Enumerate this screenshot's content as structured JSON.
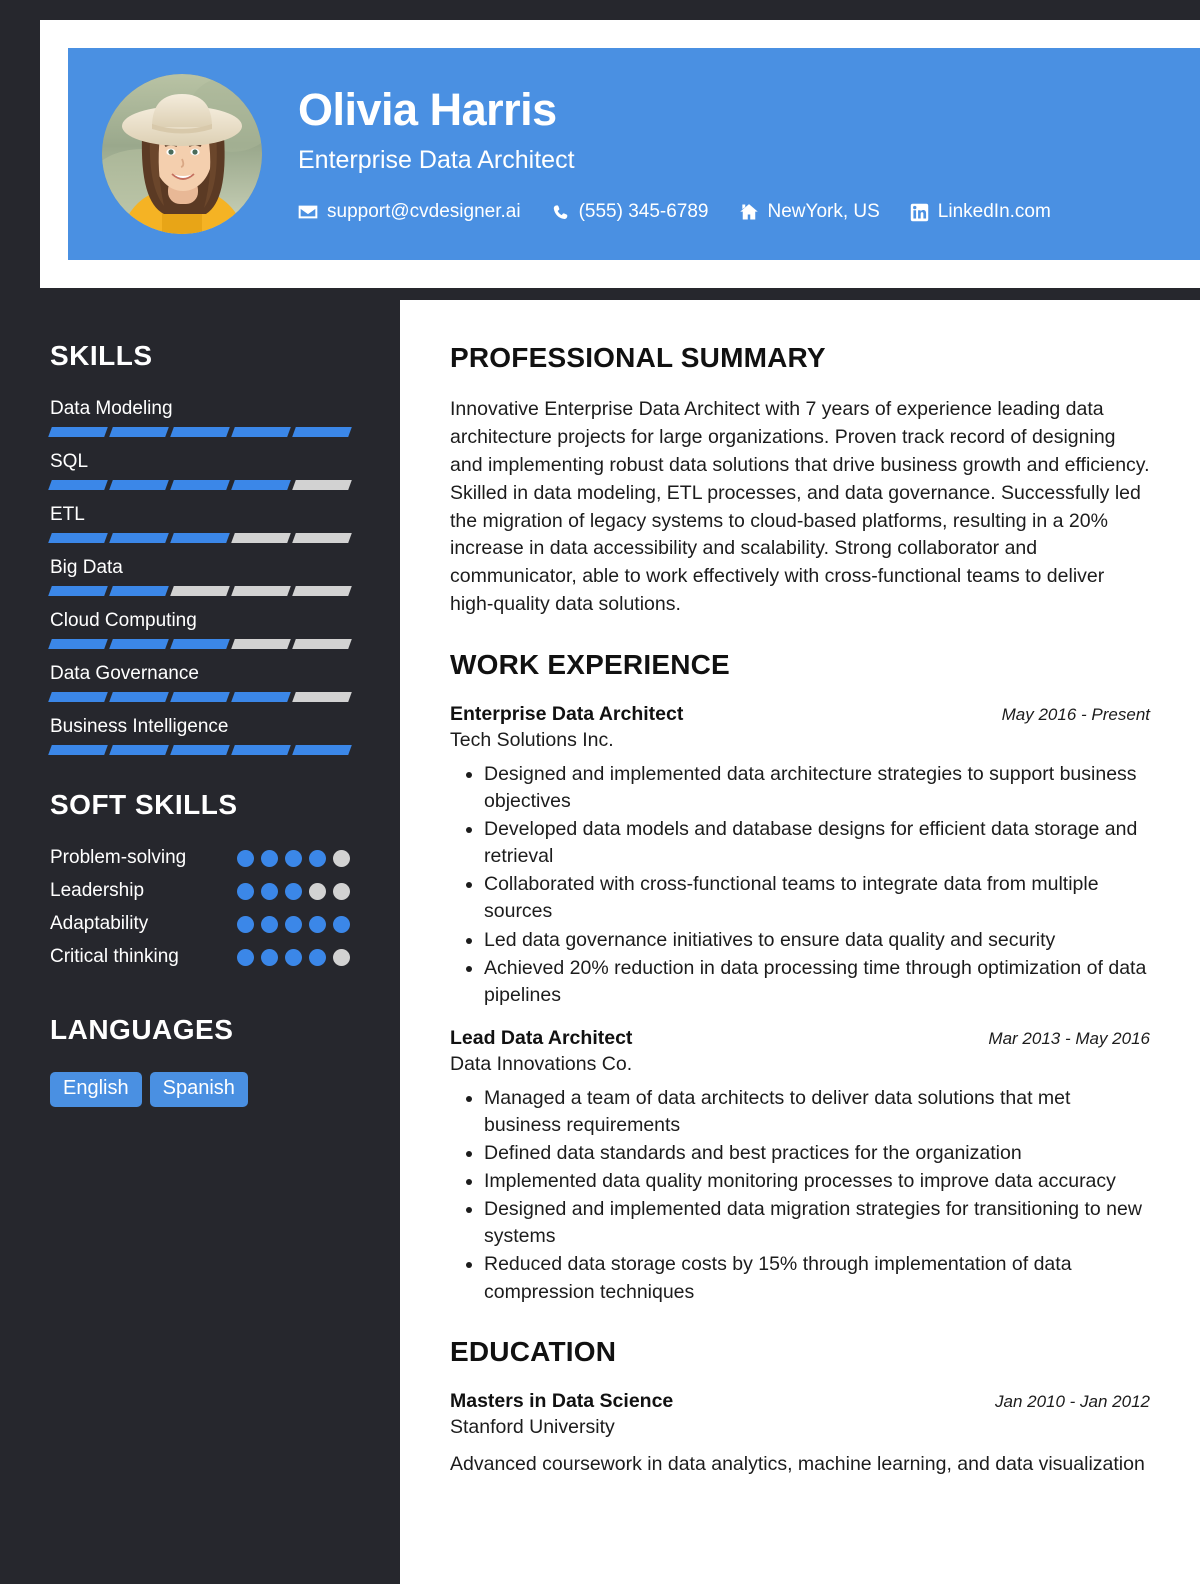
{
  "header": {
    "name": "Olivia Harris",
    "title": "Enterprise Data Architect",
    "avatar_alt": "profile-photo",
    "contacts": [
      {
        "icon": "envelope-icon",
        "text": "support@cvdesigner.ai"
      },
      {
        "icon": "phone-icon",
        "text": "(555) 345-6789"
      },
      {
        "icon": "home-icon",
        "text": "NewYork, US"
      },
      {
        "icon": "linkedin-icon",
        "text": "LinkedIn.com"
      }
    ]
  },
  "colors": {
    "accent_blue": "#4a90e2",
    "bar_blue": "#3b87e8",
    "bar_empty": "#d2d2d2",
    "sidebar_dark": "#26272d",
    "text_light": "#ffffff",
    "text_dark": "#1c1c1c"
  },
  "sidebar": {
    "skills_heading": "SKILLS",
    "skills_max": 5,
    "skills": [
      {
        "label": "Data Modeling",
        "level": 5
      },
      {
        "label": "SQL",
        "level": 4
      },
      {
        "label": "ETL",
        "level": 3
      },
      {
        "label": "Big Data",
        "level": 2
      },
      {
        "label": "Cloud Computing",
        "level": 3
      },
      {
        "label": "Data Governance",
        "level": 4
      },
      {
        "label": "Business Intelligence",
        "level": 5
      }
    ],
    "soft_skills_heading": "SOFT SKILLS",
    "soft_skills_max": 5,
    "soft_skills": [
      {
        "label": "Problem-solving",
        "level": 4
      },
      {
        "label": "Leadership",
        "level": 3
      },
      {
        "label": "Adaptability",
        "level": 5
      },
      {
        "label": "Critical thinking",
        "level": 4
      }
    ],
    "languages_heading": "LANGUAGES",
    "languages": [
      "English",
      "Spanish"
    ]
  },
  "main": {
    "summary_heading": "PROFESSIONAL SUMMARY",
    "summary_text": "Innovative Enterprise Data Architect with 7 years of experience leading data architecture projects for large organizations. Proven track record of designing and implementing robust data solutions that drive business growth and efficiency. Skilled in data modeling, ETL processes, and data governance. Successfully led the migration of legacy systems to cloud-based platforms, resulting in a 20% increase in data accessibility and scalability. Strong collaborator and communicator, able to work effectively with cross-functional teams to deliver high-quality data solutions.",
    "work_heading": "WORK EXPERIENCE",
    "work": [
      {
        "role": "Enterprise Data Architect",
        "dates": "May 2016 - Present",
        "org": "Tech Solutions Inc.",
        "bullets": [
          "Designed and implemented data architecture strategies to support business objectives",
          "Developed data models and database designs for efficient data storage and retrieval",
          "Collaborated with cross-functional teams to integrate data from multiple sources",
          "Led data governance initiatives to ensure data quality and security",
          "Achieved 20% reduction in data processing time through optimization of data pipelines"
        ]
      },
      {
        "role": "Lead Data Architect",
        "dates": "Mar 2013 - May 2016",
        "org": "Data Innovations Co.",
        "bullets": [
          "Managed a team of data architects to deliver data solutions that met business requirements",
          "Defined data standards and best practices for the organization",
          "Implemented data quality monitoring processes to improve data accuracy",
          "Designed and implemented data migration strategies for transitioning to new systems",
          "Reduced data storage costs by 15% through implementation of data compression techniques"
        ]
      }
    ],
    "education_heading": "EDUCATION",
    "education": [
      {
        "degree": "Masters in Data Science",
        "dates": "Jan 2010 - Jan 2012",
        "school": "Stanford University",
        "description": "Advanced coursework in data analytics, machine learning, and data visualization"
      }
    ]
  }
}
